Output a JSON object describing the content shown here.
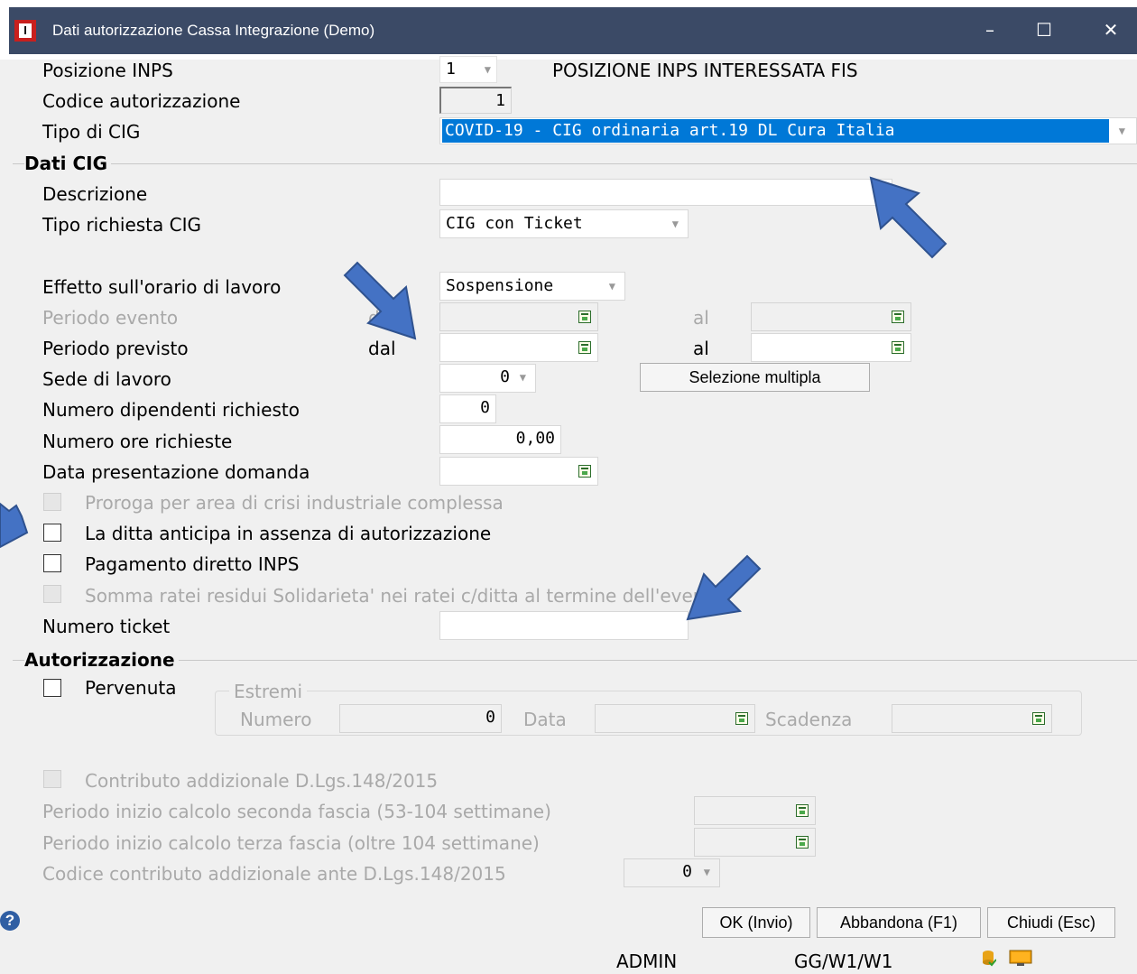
{
  "window": {
    "title": "Dati autorizzazione Cassa Integrazione  (Demo)",
    "icon_letter": "I",
    "minimize": "–",
    "maximize": "☐",
    "close": "✕"
  },
  "fields": {
    "posizione_inps": {
      "label": "Posizione INPS",
      "value": "1",
      "description": "POSIZIONE INPS INTERESSATA FIS"
    },
    "codice_autorizzazione": {
      "label": "Codice autorizzazione",
      "value": "1"
    },
    "tipo_cig": {
      "label": "Tipo di CIG",
      "value": "COVID-19 - CIG ordinaria art.19 DL Cura Italia"
    }
  },
  "dati_cig": {
    "section_title": "Dati CIG",
    "descrizione": {
      "label": "Descrizione",
      "value": ""
    },
    "tipo_richiesta": {
      "label": "Tipo richiesta CIG",
      "value": "CIG con Ticket"
    },
    "effetto_orario": {
      "label": "Effetto sull'orario di lavoro",
      "value": "Sospensione"
    },
    "periodo_evento": {
      "label": "Periodo evento",
      "dal": "dal",
      "al": "al"
    },
    "periodo_previsto": {
      "label": "Periodo previsto",
      "dal": "dal",
      "al": "al"
    },
    "sede_lavoro": {
      "label": "Sede di lavoro",
      "value": "0",
      "button": "Selezione multipla"
    },
    "numero_dipendenti": {
      "label": "Numero dipendenti richiesto",
      "value": "0"
    },
    "numero_ore": {
      "label": "Numero ore richieste",
      "value": "0,00"
    },
    "data_presentazione": {
      "label": "Data presentazione domanda"
    },
    "proroga": {
      "label": "Proroga per area di crisi industriale complessa"
    },
    "anticipa": {
      "label": "La ditta anticipa in assenza di autorizzazione"
    },
    "pagamento_diretto": {
      "label": "Pagamento diretto INPS"
    },
    "somma_ratei": {
      "label": "Somma ratei residui Solidarieta' nei ratei c/ditta al termine dell'evento"
    },
    "numero_ticket": {
      "label": "Numero ticket",
      "value": ""
    }
  },
  "autorizzazione": {
    "section_title": "Autorizzazione",
    "pervenuta": {
      "label": "Pervenuta"
    },
    "estremi": {
      "title": "Estremi",
      "numero_label": "Numero",
      "numero_value": "0",
      "data_label": "Data",
      "scadenza_label": "Scadenza"
    }
  },
  "contributo": {
    "checkbox_label": "Contributo addizionale D.Lgs.148/2015",
    "seconda_fascia": "Periodo inizio calcolo seconda fascia (53-104 settimane)",
    "terza_fascia": "Periodo inizio calcolo terza fascia (oltre 104 settimane)",
    "codice_label": "Codice contributo addizionale ante D.Lgs.148/2015",
    "codice_value": "0"
  },
  "buttons": {
    "ok": "OK (Invio)",
    "abbandona": "Abbandona (F1)",
    "chiudi": "Chiudi (Esc)"
  },
  "status": {
    "user": "ADMIN",
    "path": "GG/W1/W1"
  },
  "colors": {
    "titlebar": "#3b4a66",
    "selection": "#0078d7",
    "annotation_arrow": "#4472c4"
  }
}
